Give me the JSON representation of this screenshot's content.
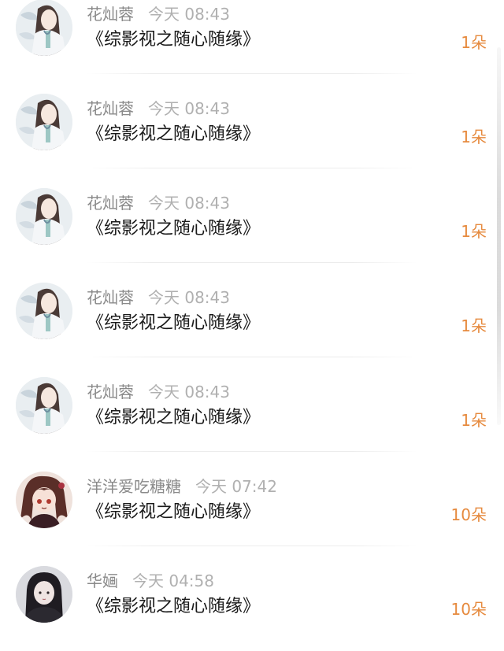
{
  "gifts": [
    {
      "name": "花灿蓉",
      "time": "今天 08:43",
      "title": "《综影视之随心随缘》",
      "amount": "1朵",
      "avatar_icon": "anime-girl-avatar-white"
    },
    {
      "name": "花灿蓉",
      "time": "今天 08:43",
      "title": "《综影视之随心随缘》",
      "amount": "1朵",
      "avatar_icon": "anime-girl-avatar-white"
    },
    {
      "name": "花灿蓉",
      "time": "今天 08:43",
      "title": "《综影视之随心随缘》",
      "amount": "1朵",
      "avatar_icon": "anime-girl-avatar-white"
    },
    {
      "name": "花灿蓉",
      "time": "今天 08:43",
      "title": "《综影视之随心随缘》",
      "amount": "1朵",
      "avatar_icon": "anime-girl-avatar-white"
    },
    {
      "name": "花灿蓉",
      "time": "今天 08:43",
      "title": "《综影视之随心随缘》",
      "amount": "1朵",
      "avatar_icon": "anime-girl-avatar-white"
    },
    {
      "name": "洋洋爱吃糖糖",
      "time": "今天 07:42",
      "title": "《综影视之随心随缘》",
      "amount": "10朵",
      "avatar_icon": "anime-girl-avatar-brown"
    },
    {
      "name": "华婳",
      "time": "今天 04:58",
      "title": "《综影视之随心随缘》",
      "amount": "10朵",
      "avatar_icon": "girl-photo-avatar-dark"
    }
  ],
  "colors": {
    "amount": "#e68a3e",
    "name": "#8a8a8a",
    "time": "#b0b0b0",
    "title": "#1a1a1a"
  }
}
